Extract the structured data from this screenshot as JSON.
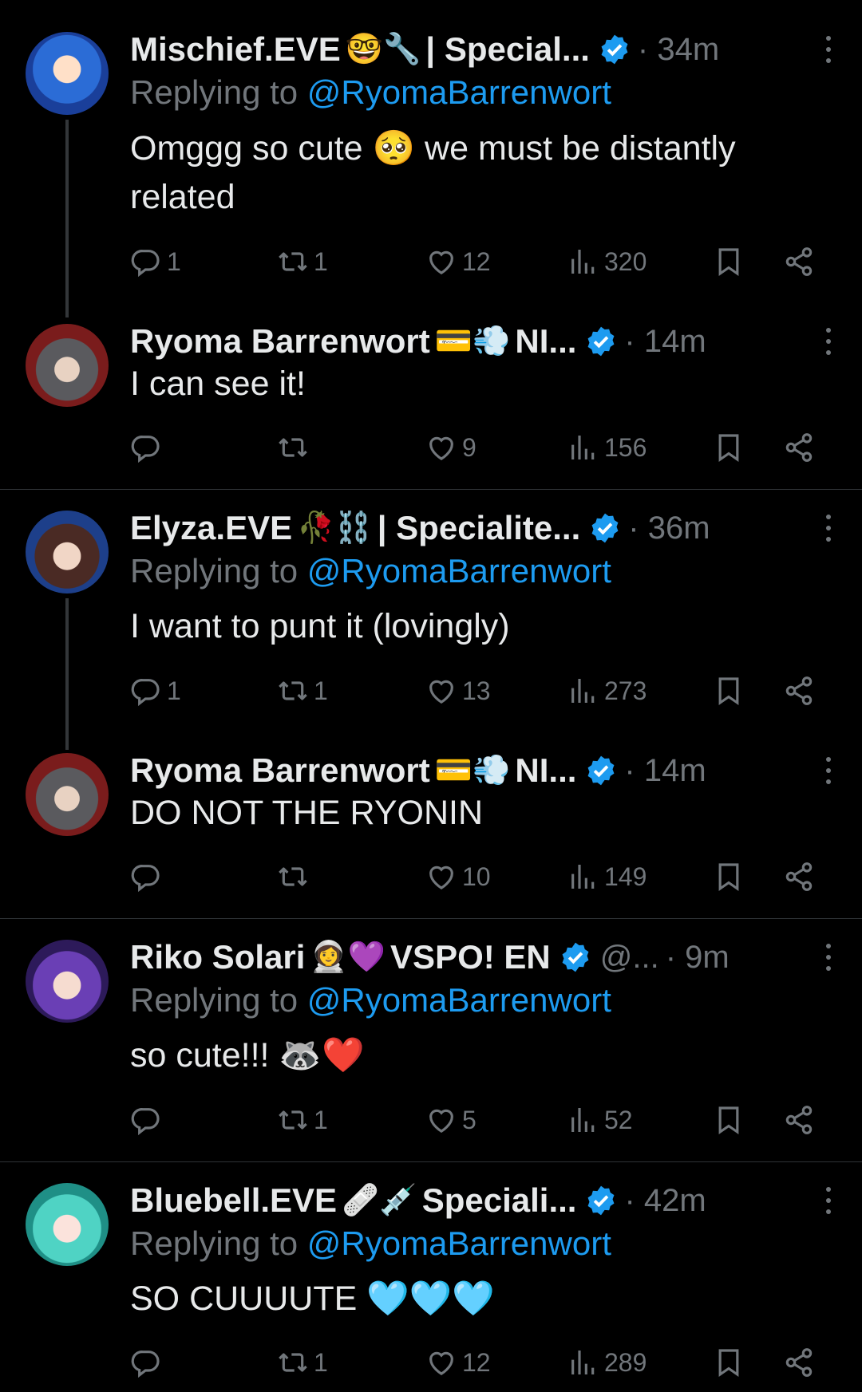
{
  "colors": {
    "background": "#000000",
    "text": "#e7e9ea",
    "muted": "#71767b",
    "link": "#1d9bf0",
    "divider": "#2f3336"
  },
  "tweets": [
    {
      "name": "Mischief.EVE",
      "emoji": "🤓🔧",
      "name2": "| Special...",
      "handle": "",
      "time": "· 34m",
      "replying": "Replying to ",
      "mention": "@RyomaBarrenwort",
      "text": "Omggg so cute 🥺 we must be distantly related",
      "replies": "1",
      "retweets": "1",
      "likes": "12",
      "views": "320"
    },
    {
      "name": "Ryoma Barrenwort",
      "emoji": "💳💨",
      "name2": "NI...",
      "handle": "",
      "time": "· 14m",
      "replying": "",
      "mention": "",
      "text": "I can see it!",
      "replies": "",
      "retweets": "",
      "likes": "9",
      "views": "156"
    },
    {
      "name": "Elyza.EVE",
      "emoji": "🥀⛓️",
      "name2": "| Specialite...",
      "handle": "",
      "time": "· 36m",
      "replying": "Replying to ",
      "mention": "@RyomaBarrenwort",
      "text": "I want to punt it (lovingly)",
      "replies": "1",
      "retweets": "1",
      "likes": "13",
      "views": "273"
    },
    {
      "name": "Ryoma Barrenwort",
      "emoji": "💳💨",
      "name2": "NI...",
      "handle": "",
      "time": "· 14m",
      "replying": "",
      "mention": "",
      "text": "DO NOT THE RYONIN",
      "replies": "",
      "retweets": "",
      "likes": "10",
      "views": "149"
    },
    {
      "name": "Riko Solari",
      "emoji": "👩‍🚀💜",
      "name2": "VSPO! EN",
      "handle": "@...",
      "time": "· 9m",
      "replying": "Replying to ",
      "mention": "@RyomaBarrenwort",
      "text": "so cute!!! 🦝❤️",
      "replies": "",
      "retweets": "1",
      "likes": "5",
      "views": "52"
    },
    {
      "name": "Bluebell.EVE",
      "emoji": "🩹💉",
      "name2": "Speciali...",
      "handle": "",
      "time": "· 42m",
      "replying": "Replying to ",
      "mention": "@RyomaBarrenwort",
      "text": "SO CUUUUTE 🩵🩵🩵",
      "replies": "",
      "retweets": "1",
      "likes": "12",
      "views": "289"
    }
  ]
}
